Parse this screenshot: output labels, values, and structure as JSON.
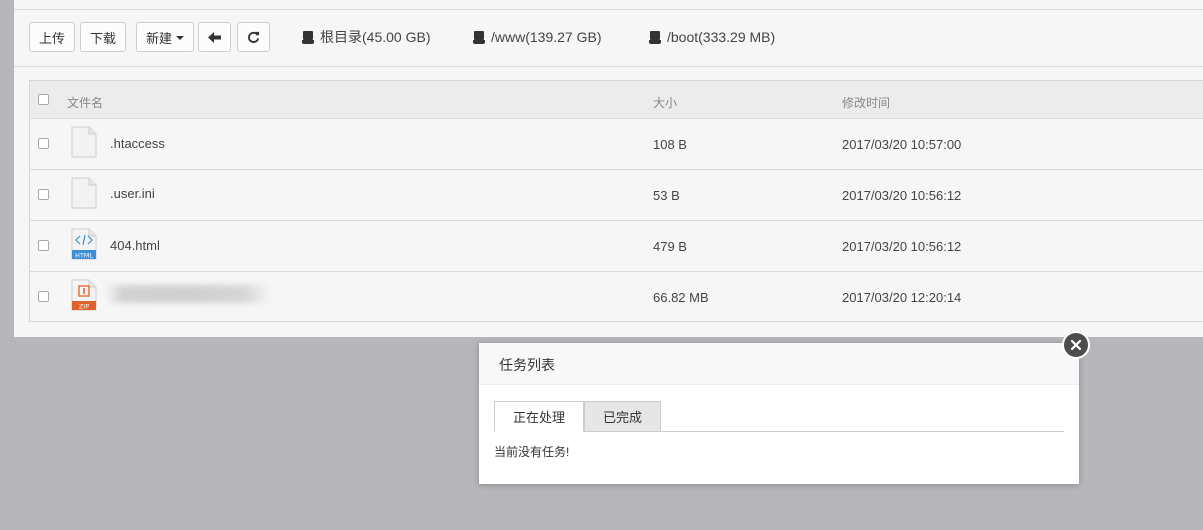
{
  "toolbar": {
    "upload_label": "上传",
    "download_label": "下载",
    "new_label": "新建",
    "disks": [
      {
        "label": "根目录(45.00 GB)"
      },
      {
        "label": "/www(139.27 GB)"
      },
      {
        "label": "/boot(333.29 MB)"
      }
    ]
  },
  "table": {
    "headers": {
      "name": "文件名",
      "size": "大小",
      "mtime": "修改时间"
    },
    "rows": [
      {
        "name": ".htaccess",
        "size": "108 B",
        "mtime": "2017/03/20 10:57:00",
        "icon": "file-icon"
      },
      {
        "name": ".user.ini",
        "size": "53 B",
        "mtime": "2017/03/20 10:56:12",
        "icon": "file-icon"
      },
      {
        "name": "404.html",
        "size": "479 B",
        "mtime": "2017/03/20 10:56:12",
        "icon": "html-file-icon",
        "badge": "HTML"
      },
      {
        "name": "",
        "size": "66.82 MB",
        "mtime": "2017/03/20 12:20:14",
        "icon": "zip-file-icon",
        "badge": "ZIP"
      }
    ]
  },
  "modal": {
    "title": "任务列表",
    "tabs": [
      {
        "label": "正在处理"
      },
      {
        "label": "已完成"
      }
    ],
    "empty_message": "当前没有任务!"
  },
  "colors": {
    "html_badge": "#3a8fd6",
    "zip_badge": "#e0612a",
    "backdrop": "#b7b7bb"
  }
}
